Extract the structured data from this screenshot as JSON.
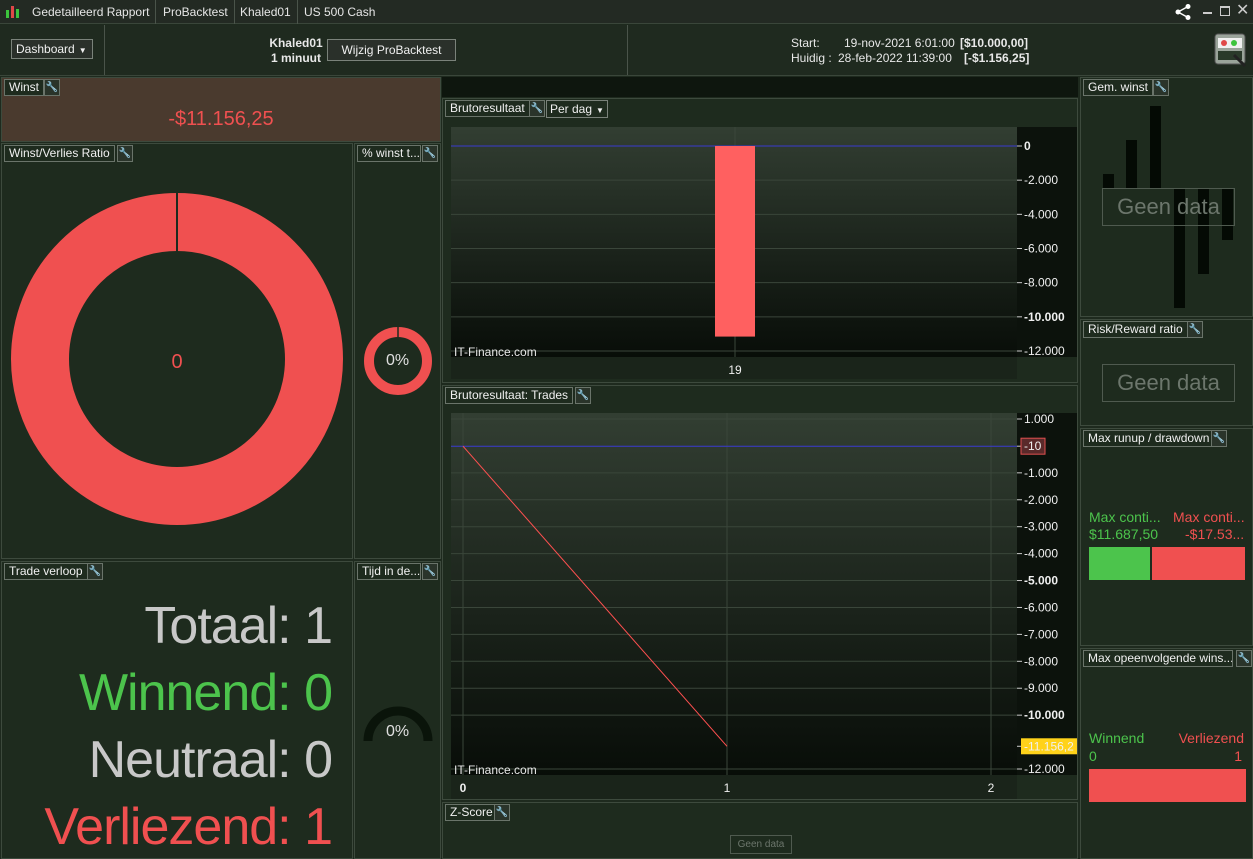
{
  "titlebar": {
    "items": [
      "Gedetailleerd Rapport",
      "ProBacktest",
      "Khaled01",
      "US 500 Cash"
    ]
  },
  "toolbar": {
    "dashboard_label": "Dashboard",
    "strategy_name": "Khaled01",
    "timeframe": "1 minuut",
    "modify_button": "Wijzig ProBacktest",
    "start_label": "Start:",
    "start_date": "19-nov-2021 6:01:00",
    "start_value": "[$10.000,00]",
    "current_label": "Huidig :",
    "current_date": "28-feb-2022 11:39:00",
    "current_value": "[-$1.156,25]"
  },
  "winst": {
    "title": "Winst",
    "value": "-$11.156,25"
  },
  "ratio": {
    "title": "Winst/Verlies Ratio",
    "center": "0"
  },
  "pct_winst": {
    "title": "% winst t...",
    "value": "0%"
  },
  "trade_verloop": {
    "title": "Trade verloop",
    "rows": [
      {
        "label": "Totaal:",
        "value": "1"
      },
      {
        "label": "Winnend:",
        "value": "0"
      },
      {
        "label": "Neutraal:",
        "value": "0"
      },
      {
        "label": "Verliezend:",
        "value": "1"
      }
    ]
  },
  "tijd": {
    "title": "Tijd in de...",
    "value": "0%"
  },
  "bruto_dag": {
    "title": "Brutoresultaat",
    "mode": "Per dag",
    "watermark": "IT-Finance.com"
  },
  "bruto_trades": {
    "title": "Brutoresultaat: Trades",
    "watermark": "IT-Finance.com"
  },
  "zscore": {
    "title": "Z-Score",
    "nodata": "Geen data"
  },
  "gem_winst": {
    "title": "Gem. winst",
    "nodata": "Geen data"
  },
  "risk_reward": {
    "title": "Risk/Reward ratio",
    "nodata": "Geen data"
  },
  "max_runup": {
    "title": "Max runup / drawdown",
    "left_label": "Max conti...",
    "left_value": "$11.687,50",
    "right_label": "Max conti...",
    "right_value": "-$17.53..."
  },
  "max_opeen": {
    "title": "Max opeenvolgende wins...",
    "win_label": "Winnend",
    "win_value": "0",
    "lose_label": "Verliezend",
    "lose_value": "1"
  },
  "colors": {
    "red": "#f05050",
    "green": "#4cc44c",
    "gray": "#c8c8c8",
    "bar": "#ff6060",
    "zero_line": "#3a3ad0",
    "marker": "#ffd21a"
  },
  "chart_data": [
    {
      "type": "bar",
      "categories": [
        "19"
      ],
      "values": [
        -11156.25
      ],
      "yticks": [
        0,
        -2000,
        -4000,
        -6000,
        -8000,
        -10000,
        -12000
      ],
      "ytick_labels": [
        "0",
        "-2.000",
        "-4.000",
        "-6.000",
        "-8.000",
        "-10.000",
        "-12.000"
      ],
      "ylim": [
        -12000,
        0
      ]
    },
    {
      "type": "line",
      "x": [
        0,
        1
      ],
      "y": [
        -10,
        -11156.25
      ],
      "xticks": [
        0,
        1,
        2
      ],
      "xtick_labels": [
        "0",
        "1",
        "2"
      ],
      "yticks": [
        1000,
        -10,
        -1000,
        -2000,
        -3000,
        -4000,
        -5000,
        -6000,
        -7000,
        -8000,
        -9000,
        -10000,
        -11156.25,
        -12000
      ],
      "ytick_labels": [
        "1.000",
        "-10",
        "-1.000",
        "-2.000",
        "-3.000",
        "-4.000",
        "-5.000",
        "-6.000",
        "-7.000",
        "-8.000",
        "-9.000",
        "-10.000",
        "-11.156,2",
        "-12.000"
      ],
      "ylim": [
        -12000,
        1000
      ]
    }
  ]
}
